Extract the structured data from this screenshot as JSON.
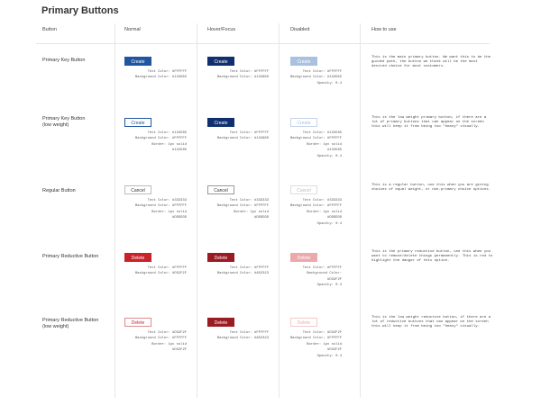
{
  "page_title": "Primary Buttons",
  "columns": [
    "Button",
    "Normal",
    "Hover/Focus",
    "Disabled",
    "How to use"
  ],
  "rows": [
    {
      "label_lines": [
        "Primary Key Button"
      ],
      "button_label": "Create",
      "states": {
        "normal": {
          "style": {
            "bg": "#1F56A0",
            "fg": "#FFFFFF",
            "border": "#1F56A0"
          },
          "spec_lines": [
            "Text Color: #FFFFFF",
            "Background Color: #134585"
          ]
        },
        "hover": {
          "style": {
            "bg": "#0F2F6E",
            "fg": "#FFFFFF",
            "border": "#0F2F6E"
          },
          "spec_lines": [
            "Text Color: #FFFFFF",
            "Background Color: #134980"
          ]
        },
        "disabled": {
          "style": {
            "bg": "#A9C0E0",
            "fg": "#FFFFFF",
            "border": "#A9C0E0"
          },
          "spec_lines": [
            "Text Color: #FFFFFF",
            "Background Color: #134585",
            "Opacity: 0.4"
          ]
        }
      },
      "description": "This is the main primary button. We want this to be the guided path, the button we think will be the most desired choice for most customers."
    },
    {
      "label_lines": [
        "Primary Key Button",
        "(low weight)"
      ],
      "button_label": "Create",
      "states": {
        "normal": {
          "style": {
            "bg": "#FFFFFF",
            "fg": "#1F56A0",
            "border": "#1F56A0"
          },
          "spec_lines": [
            "Text Color: #134585",
            "Background Color: #FFFFFF",
            "Border: 1px solid",
            "#134585"
          ]
        },
        "hover": {
          "style": {
            "bg": "#0F2F6E",
            "fg": "#FFFFFF",
            "border": "#0F2F6E"
          },
          "spec_lines": [
            "Text Color: #FFFFFF",
            "Background Color: #134980"
          ]
        },
        "disabled": {
          "style": {
            "bg": "#FFFFFF",
            "fg": "#A9C0E0",
            "border": "#C5D4EA"
          },
          "spec_lines": [
            "Text Color: #134585",
            "Background Color: #FFFFFF",
            "Border: 1px solid",
            "#134585",
            "Opacity: 0.4"
          ]
        }
      },
      "description": "This is the low weight primary button, if there are a lot of primary buttons that can appear on the screen this will keep it from being too \"heavy\" visually."
    },
    {
      "label_lines": [
        "Regular Button"
      ],
      "button_label": "Cancel",
      "states": {
        "normal": {
          "style": {
            "bg": "#FFFFFF",
            "fg": "#333333",
            "border": "#BBBBBB"
          },
          "spec_lines": [
            "Text Color: #333333",
            "Background Color: #FFFFFF",
            "Border: 1px solid",
            "#DDDDDD"
          ]
        },
        "hover": {
          "style": {
            "bg": "#FFFFFF",
            "fg": "#333333",
            "border": "#999999"
          },
          "spec_lines": [
            "Text Color: #333333",
            "Background Color: #FFFFFF",
            "Border: 1px solid",
            "#DDDDDD"
          ]
        },
        "disabled": {
          "style": {
            "bg": "#FFFFFF",
            "fg": "#BBBBBB",
            "border": "#DDDDDD"
          },
          "spec_lines": [
            "Text Color: #333333",
            "Background Color: #FFFFFF",
            "Border: 1px solid",
            "#DDDDDD",
            "Opacity: 0.4"
          ]
        }
      },
      "description": "This is a regular button, use this when you are giving choices of equal weight, or non-primary choice options."
    },
    {
      "label_lines": [
        "Primary Reductive Button"
      ],
      "button_label": "Delete",
      "states": {
        "normal": {
          "style": {
            "bg": "#C8232C",
            "fg": "#FFFFFF",
            "border": "#C8232C"
          },
          "spec_lines": [
            "Text Color: #FFFFFF",
            "Background Color: #D32F2F"
          ]
        },
        "hover": {
          "style": {
            "bg": "#9B1B22",
            "fg": "#FFFFFF",
            "border": "#9B1B22"
          },
          "spec_lines": [
            "Text Color: #FFFFFF",
            "Background Color: #A52323"
          ]
        },
        "disabled": {
          "style": {
            "bg": "#EBA9AC",
            "fg": "#FFFFFF",
            "border": "#EBA9AC"
          },
          "spec_lines": [
            "Text Color: #FFFFFF",
            "Background Color:",
            "#D32F2F",
            "Opacity: 0.4"
          ]
        }
      },
      "description": "This is the primary reductive button, use this when you want to remove/delete things permanently. This is red to highlight the danger of this option."
    },
    {
      "label_lines": [
        "Primary Reductive Button",
        "(low weight)"
      ],
      "button_label": "Delete",
      "states": {
        "normal": {
          "style": {
            "bg": "#FFFFFF",
            "fg": "#C8232C",
            "border": "#E08A8F"
          },
          "spec_lines": [
            "Text Color: #D32F2F",
            "Background Color: #FFFFFF",
            "Border: 1px solid",
            "#D32F2F"
          ]
        },
        "hover": {
          "style": {
            "bg": "#9B1B22",
            "fg": "#FFFFFF",
            "border": "#9B1B22"
          },
          "spec_lines": [
            "Text Color: #FFFFFF",
            "Background Color: #A52323"
          ]
        },
        "disabled": {
          "style": {
            "bg": "#FFFFFF",
            "fg": "#EBA9AC",
            "border": "#F2C9CB"
          },
          "spec_lines": [
            "Text Color: #D32F2F",
            "Background Color: #FFFFFF",
            "Border: 1px solid",
            "#D32F2F",
            "Opacity: 0.4"
          ]
        }
      },
      "description": "This is the low weight reductive button, if there are a lot of reductive buttons that can appear on the screen this will keep it from being too \"heavy\" visually."
    }
  ]
}
